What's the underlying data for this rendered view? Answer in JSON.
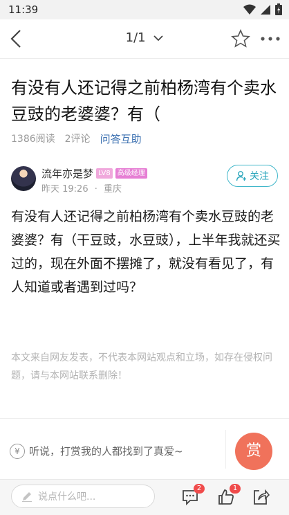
{
  "status_bar": {
    "time": "11:39"
  },
  "nav": {
    "page_indicator": "1/1"
  },
  "post": {
    "title": "有没有人还记得之前柏杨湾有个卖水豆豉的老婆婆？有（",
    "reads": "1386阅读",
    "comments": "2评论",
    "category": "问答互助",
    "body": "有没有人还记得之前柏杨湾有个卖水豆豉的老婆婆？有（干豆豉，水豆豉），上半年我就还买过的，现在外面不摆摊了，就没有看见了，有人知道或者遇到过吗？",
    "disclaimer": "本文来自网友发表，不代表本网站观点和立场，如存在侵权问题，请与本网站联系删除！"
  },
  "author": {
    "name": "流年亦是梦",
    "level_badge": "LV8",
    "rank_badge": "高级经理",
    "time": "昨天 19:26",
    "separator": "·",
    "location": "重庆",
    "follow_label": "关注"
  },
  "reward": {
    "currency_symbol": "¥",
    "prompt": "听说，打赏我的人都找到了真爱~",
    "button_label": "赏"
  },
  "bottom_bar": {
    "comment_placeholder": "说点什么吧...",
    "comment_count": "2",
    "like_count": "1"
  },
  "colors": {
    "accent_teal": "#2aa6bc",
    "reward_red": "#f0725b",
    "link_blue": "#3a6fb0",
    "badge_pink": "#e67fd4"
  }
}
